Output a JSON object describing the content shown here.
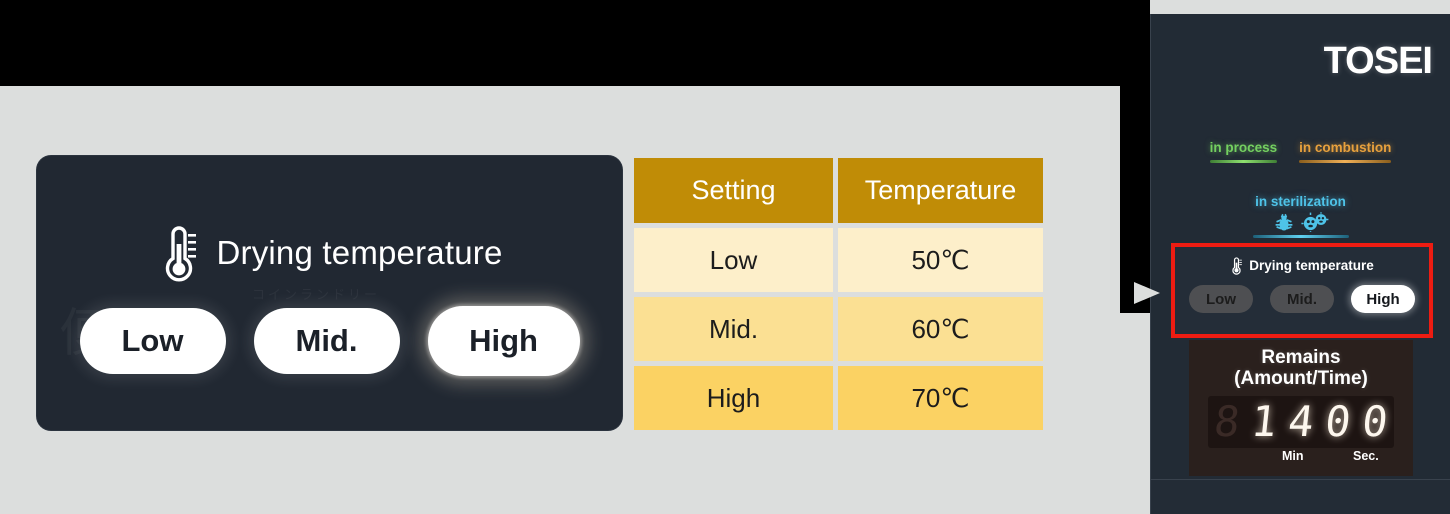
{
  "control_card": {
    "title": "Drying temperature",
    "thermometer_icon": "thermometer-icon",
    "options": [
      {
        "label": "Low",
        "selected": false
      },
      {
        "label": "Mid.",
        "selected": false
      },
      {
        "label": "High",
        "selected": true
      }
    ]
  },
  "table": {
    "headers": [
      "Setting",
      "Temperature"
    ],
    "rows": [
      {
        "setting": "Low",
        "temperature": "50℃"
      },
      {
        "setting": "Mid.",
        "temperature": "60℃"
      },
      {
        "setting": "High",
        "temperature": "70℃"
      }
    ]
  },
  "device": {
    "brand": "TOSEI",
    "statuses": [
      {
        "label": "in process",
        "color": "#74d060"
      },
      {
        "label": "in combustion",
        "color": "#e8a13d"
      }
    ],
    "sterilization": {
      "label": "in sterilization",
      "color": "#4ec3e8",
      "icons": [
        "mite-icon",
        "bacteria-icon"
      ]
    },
    "drying": {
      "title": "Drying temperature",
      "thermometer_icon": "thermometer-icon",
      "options": [
        {
          "label": "Low",
          "selected": false
        },
        {
          "label": "Mid.",
          "selected": false
        },
        {
          "label": "High",
          "selected": true
        }
      ]
    },
    "remains": {
      "title_line1": "Remains",
      "title_line2": "(Amount/Time)",
      "digits": [
        {
          "value": "8",
          "lit": false
        },
        {
          "value": "1",
          "lit": true
        },
        {
          "value": "4",
          "lit": true
        },
        {
          "value": "0",
          "lit": true
        },
        {
          "value": "0",
          "lit": true
        }
      ],
      "unit_min": "Min",
      "unit_sec": "Sec."
    },
    "highlight_color": "#ee1c12"
  },
  "watermark": {
    "glyph": "便",
    "sub": "コインランドリー"
  }
}
